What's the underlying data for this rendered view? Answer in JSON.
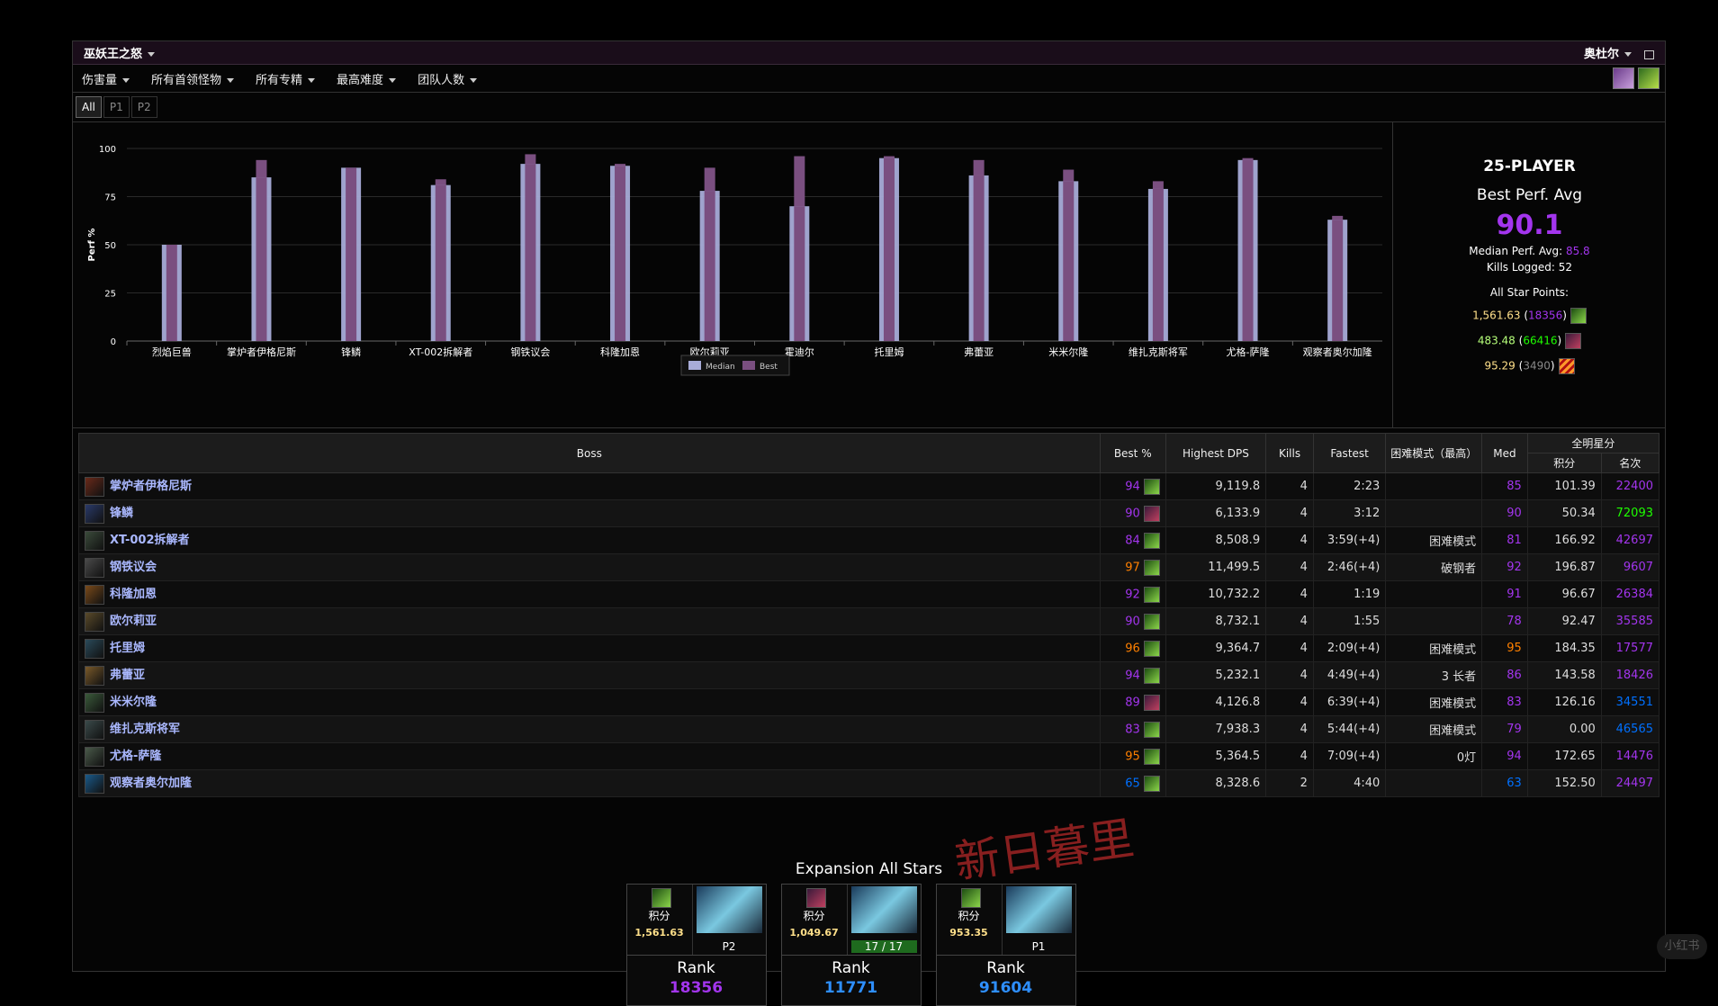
{
  "header": {
    "zone": "巫妖王之怒",
    "server": "奥杜尔"
  },
  "filters": [
    "伤害量",
    "所有首领怪物",
    "所有专精",
    "最高难度",
    "团队人数"
  ],
  "tabs": [
    "All",
    "P1",
    "P2"
  ],
  "colors": {
    "median": "#a8acd8",
    "best": "#7a4f80",
    "epic": "#a335ee",
    "legendary": "#ff8000",
    "rare": "#0070ff",
    "uncommon": "#1eff00",
    "astounding": "#e268a8"
  },
  "chart_data": {
    "type": "bar",
    "ylabel": "Perf %",
    "ylim": [
      0,
      100
    ],
    "yticks": [
      0,
      25,
      50,
      75,
      100
    ],
    "categories": [
      "烈焰巨兽",
      "掌炉者伊格尼斯",
      "锋鳞",
      "XT-002拆解者",
      "钢铁议会",
      "科隆加恩",
      "欧尔莉亚",
      "霍迪尔",
      "托里姆",
      "弗蕾亚",
      "米米尔隆",
      "维扎克斯将军",
      "尤格-萨隆",
      "观察者奥尔加隆"
    ],
    "series": [
      {
        "name": "Median",
        "values": [
          50,
          85,
          90,
          81,
          92,
          91,
          78,
          70,
          95,
          86,
          83,
          79,
          94,
          63
        ]
      },
      {
        "name": "Best",
        "values": [
          50,
          94,
          90,
          84,
          97,
          92,
          90,
          96,
          96,
          94,
          89,
          83,
          95,
          65
        ]
      }
    ],
    "legend": "bottom-center"
  },
  "summary": {
    "title": "25-PLAYER",
    "subtitle": "Best Perf. Avg",
    "best_avg": "90.1",
    "median_label": "Median Perf. Avg:",
    "median_value": "85.8",
    "kills_label": "Kills Logged:",
    "kills_value": "52",
    "allstar_label": "All Star Points:",
    "points": [
      {
        "value": "1,561.63",
        "rank": "18356",
        "rank_color": "#a335ee",
        "icon": "nature-spec-icon"
      },
      {
        "value": "483.48",
        "rank": "66416",
        "rank_color": "#1eff00",
        "icon": "demon-spec-icon"
      },
      {
        "value": "95.29",
        "rank": "3490",
        "rank_color": "#888",
        "icon": "fire-spec-icon"
      }
    ]
  },
  "table": {
    "headers": {
      "boss": "Boss",
      "best": "Best %",
      "dps": "Highest DPS",
      "kills": "Kills",
      "fastest": "Fastest",
      "hard": "困难模式（最高）",
      "med": "Med",
      "allstar": "全明星分",
      "points": "积分",
      "rank": "名次"
    },
    "rows": [
      {
        "name": "掌炉者伊格尼斯",
        "best": "94",
        "best_color": "#a335ee",
        "dps": "9,119.8",
        "kills": "4",
        "fastest": "2:23",
        "hard": "",
        "med": "85",
        "med_color": "#a335ee",
        "points": "101.39",
        "rank": "22400",
        "rank_color": "#a335ee",
        "spec": "nature"
      },
      {
        "name": "锋鳞",
        "best": "90",
        "best_color": "#a335ee",
        "dps": "6,133.9",
        "kills": "4",
        "fastest": "3:12",
        "hard": "",
        "med": "90",
        "med_color": "#a335ee",
        "points": "50.34",
        "rank": "72093",
        "rank_color": "#1eff00",
        "spec": "demon"
      },
      {
        "name": "XT-002拆解者",
        "best": "84",
        "best_color": "#a335ee",
        "dps": "8,508.9",
        "kills": "4",
        "fastest": "3:59(+4)",
        "hard": "困难模式",
        "med": "81",
        "med_color": "#a335ee",
        "points": "166.92",
        "rank": "42697",
        "rank_color": "#a335ee",
        "spec": "nature"
      },
      {
        "name": "钢铁议会",
        "best": "97",
        "best_color": "#ff8000",
        "dps": "11,499.5",
        "kills": "4",
        "fastest": "2:46(+4)",
        "hard": "破钢者",
        "med": "92",
        "med_color": "#a335ee",
        "points": "196.87",
        "rank": "9607",
        "rank_color": "#a335ee",
        "spec": "nature"
      },
      {
        "name": "科隆加恩",
        "best": "92",
        "best_color": "#a335ee",
        "dps": "10,732.2",
        "kills": "4",
        "fastest": "1:19",
        "hard": "",
        "med": "91",
        "med_color": "#a335ee",
        "points": "96.67",
        "rank": "26384",
        "rank_color": "#a335ee",
        "spec": "nature"
      },
      {
        "name": "欧尔莉亚",
        "best": "90",
        "best_color": "#a335ee",
        "dps": "8,732.1",
        "kills": "4",
        "fastest": "1:55",
        "hard": "",
        "med": "78",
        "med_color": "#a335ee",
        "points": "92.47",
        "rank": "35585",
        "rank_color": "#a335ee",
        "spec": "nature"
      },
      {
        "name": "托里姆",
        "best": "96",
        "best_color": "#ff8000",
        "dps": "9,364.7",
        "kills": "4",
        "fastest": "2:09(+4)",
        "hard": "困难模式",
        "med": "95",
        "med_color": "#ff8000",
        "points": "184.35",
        "rank": "17577",
        "rank_color": "#a335ee",
        "spec": "nature"
      },
      {
        "name": "弗蕾亚",
        "best": "94",
        "best_color": "#a335ee",
        "dps": "5,232.1",
        "kills": "4",
        "fastest": "4:49(+4)",
        "hard": "3 长者",
        "med": "86",
        "med_color": "#a335ee",
        "points": "143.58",
        "rank": "18426",
        "rank_color": "#a335ee",
        "spec": "nature"
      },
      {
        "name": "米米尔隆",
        "best": "89",
        "best_color": "#a335ee",
        "dps": "4,126.8",
        "kills": "4",
        "fastest": "6:39(+4)",
        "hard": "困难模式",
        "med": "83",
        "med_color": "#a335ee",
        "points": "126.16",
        "rank": "34551",
        "rank_color": "#0070ff",
        "spec": "demon"
      },
      {
        "name": "维扎克斯将军",
        "best": "83",
        "best_color": "#a335ee",
        "dps": "7,938.3",
        "kills": "4",
        "fastest": "5:44(+4)",
        "hard": "困难模式",
        "med": "79",
        "med_color": "#a335ee",
        "points": "0.00",
        "rank": "46565",
        "rank_color": "#0070ff",
        "spec": "nature"
      },
      {
        "name": "尤格-萨隆",
        "best": "95",
        "best_color": "#ff8000",
        "dps": "5,364.5",
        "kills": "4",
        "fastest": "7:09(+4)",
        "hard": "0灯",
        "med": "94",
        "med_color": "#a335ee",
        "points": "172.65",
        "rank": "14476",
        "rank_color": "#a335ee",
        "spec": "nature"
      },
      {
        "name": "观察者奥尔加隆",
        "best": "65",
        "best_color": "#0070ff",
        "dps": "8,328.6",
        "kills": "2",
        "fastest": "4:40",
        "hard": "",
        "med": "63",
        "med_color": "#0070ff",
        "points": "152.50",
        "rank": "24497",
        "rank_color": "#a335ee",
        "spec": "nature"
      }
    ]
  },
  "expansion": {
    "title": "Expansion All Stars",
    "cards": [
      {
        "label": "积分",
        "points": "1,561.63",
        "tag": "P2",
        "rank_label": "Rank",
        "rank": "18356",
        "rank_color": "#a335ee",
        "spec": "nature"
      },
      {
        "label": "积分",
        "points": "1,049.67",
        "tag": "17 / 17",
        "rank_label": "Rank",
        "rank": "11771",
        "rank_color": "#2e8fff",
        "spec": "demon"
      },
      {
        "label": "积分",
        "points": "953.35",
        "tag": "P1",
        "rank_label": "Rank",
        "rank": "91604",
        "rank_color": "#2e8fff",
        "spec": "nature"
      }
    ]
  },
  "watermark": "新日暮里",
  "corner_logo": "小红书"
}
